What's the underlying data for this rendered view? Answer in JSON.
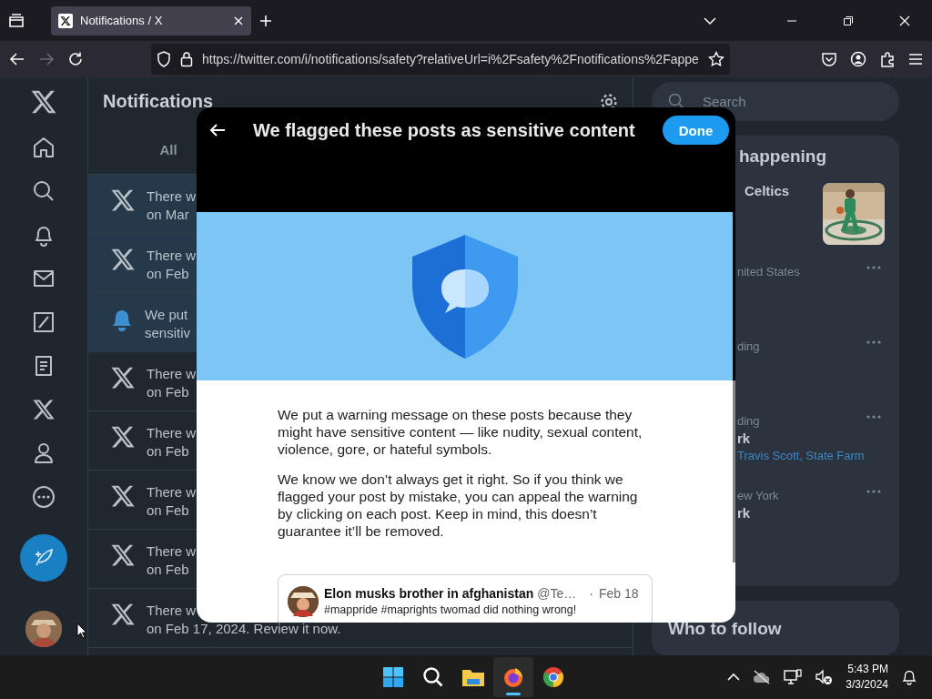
{
  "browser": {
    "tab": {
      "title": "Notifications / X",
      "selected": true
    },
    "url": "https://twitter.com/i/notifications/safety?relativeUrl=i%2Fsafety%2Fnotifications%2Fappe",
    "forward_disabled": true
  },
  "notifications": {
    "title": "Notifications",
    "tabs": [
      {
        "label": "All"
      }
    ],
    "rows": [
      {
        "kind": "x",
        "unread": true,
        "line1": "There w",
        "line2": "on Mar"
      },
      {
        "kind": "x",
        "unread": true,
        "line1": "There w",
        "line2": "on Feb"
      },
      {
        "kind": "bell",
        "unread": true,
        "line1": "We put",
        "line2": "sensitiv"
      },
      {
        "kind": "x",
        "unread": false,
        "line1": "There w",
        "line2": "on Feb"
      },
      {
        "kind": "x",
        "unread": false,
        "line1": "There w",
        "line2": "on Feb"
      },
      {
        "kind": "x",
        "unread": false,
        "line1": "There w",
        "line2": "on Feb"
      },
      {
        "kind": "x",
        "unread": false,
        "line1": "There w",
        "line2": "on Feb"
      },
      {
        "kind": "x",
        "unread": false,
        "line1": "There w",
        "line2": "on Feb 17, 2024. Review it now."
      }
    ]
  },
  "sidebar": {
    "search": {
      "placeholder": "Search"
    },
    "trends": {
      "title": "happening",
      "items": [
        {
          "kind": "featured",
          "name": "Celtics"
        },
        {
          "kind": "trend",
          "context": "nited States"
        },
        {
          "kind": "trend",
          "context": "ding"
        },
        {
          "kind": "trend",
          "context": "ding",
          "name": "rk",
          "related": "Travis Scott, State Farm"
        },
        {
          "kind": "trend",
          "context": "ew York",
          "name": "rk"
        }
      ]
    },
    "who_to_follow": {
      "title": "Who to follow"
    }
  },
  "modal": {
    "title": "We flagged these posts as sensitive content",
    "done": "Done",
    "paragraphs": [
      "We put a warning message on these posts because they might have sensitive content — like nudity, sexual content, violence, gore, or hateful symbols.",
      "We know we don’t always get it right. So if you think we flagged your post by mistake, you can appeal the warning by clicking on each post. Keep in mind, this doesn’t guarantee it’ll be removed."
    ],
    "post": {
      "author": "Elon musks brother in afghanistan",
      "handle": "@Te…",
      "separator": "·",
      "date": "Feb 18",
      "text": "#mappride #maprights twomad did nothing wrong!"
    }
  },
  "taskbar": {
    "apps": [
      {
        "kind": "start",
        "active": false
      },
      {
        "kind": "search",
        "active": false
      },
      {
        "kind": "folder",
        "active": false
      },
      {
        "kind": "firefox",
        "active": true
      },
      {
        "kind": "chrome",
        "active": false
      }
    ],
    "clock": {
      "time": "5:43 PM",
      "date": "3/3/2024"
    }
  }
}
